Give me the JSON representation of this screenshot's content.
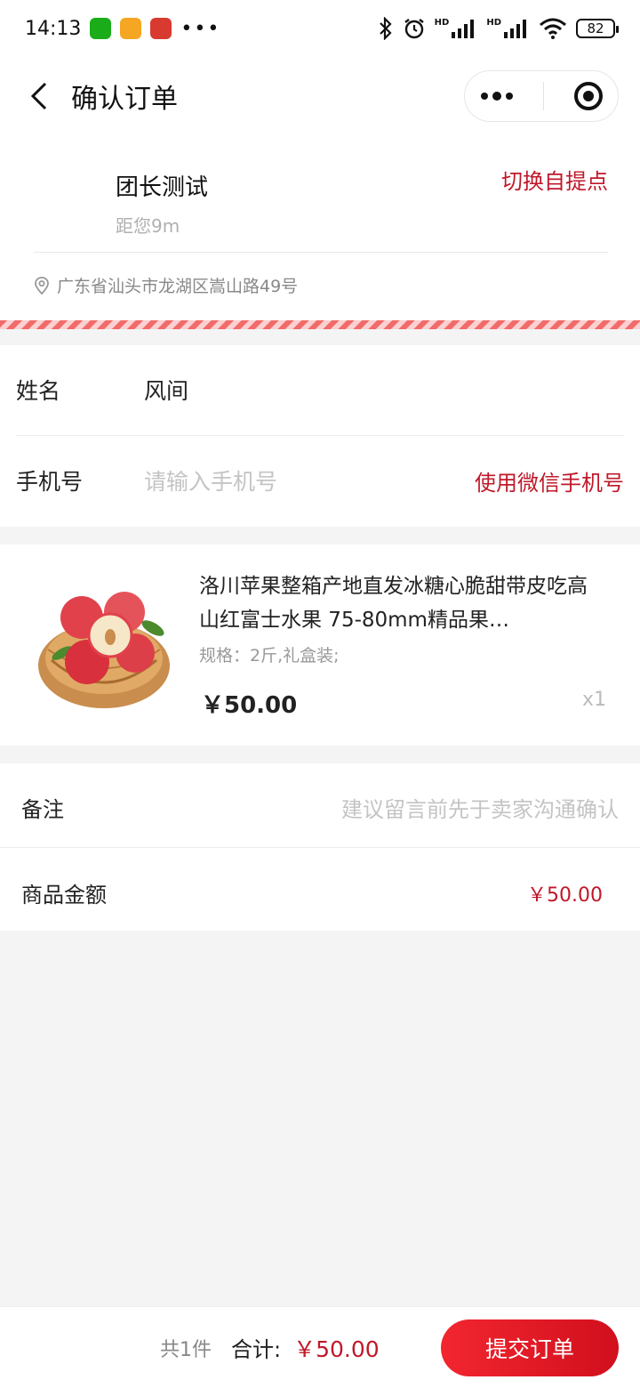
{
  "status_bar": {
    "time": "14:13",
    "dots": "•••",
    "battery": "82",
    "hd1": "HD",
    "hd2": "HD"
  },
  "nav": {
    "title": "确认订单"
  },
  "pickup": {
    "leader_name": "团长测试",
    "distance": "距您9m",
    "switch_label": "切换自提点",
    "address": "广东省汕头市龙湖区嵩山路49号"
  },
  "contact": {
    "name_label": "姓名",
    "name_value": "风间",
    "phone_label": "手机号",
    "phone_placeholder": "请输入手机号",
    "use_wechat_phone": "使用微信手机号"
  },
  "product": {
    "title": "洛川苹果整箱产地直发冰糖心脆甜带皮吃高山红富士水果 75-80mm精品果…",
    "spec": "规格：2斤,礼盒装;",
    "price": "￥50.00",
    "quantity": "x1"
  },
  "summary": {
    "remark_label": "备注",
    "remark_placeholder": "建议留言前先于卖家沟通确认",
    "goods_amount_label": "商品金额",
    "goods_amount": "￥50.00"
  },
  "bottom_bar": {
    "count": "共1件",
    "total_label": "合计:",
    "total_value": "￥50.00",
    "submit_label": "提交订单"
  },
  "colors": {
    "accent": "#c0182a",
    "button": "#e3141f"
  },
  "icons": [
    "back-arrow-icon",
    "more-dots-icon",
    "target-close-icon",
    "location-pin-icon",
    "bluetooth-icon",
    "alarm-icon",
    "signal-icon",
    "wifi-icon",
    "battery-icon"
  ]
}
